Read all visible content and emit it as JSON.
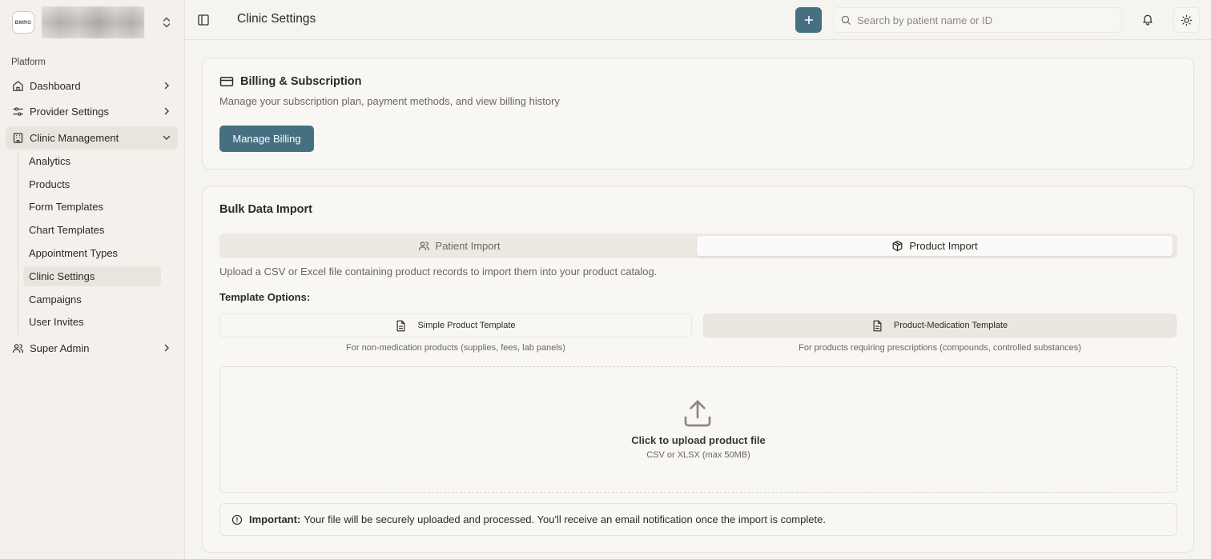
{
  "org": {
    "logo_text": "BMRG",
    "name": ""
  },
  "sidebar": {
    "group_label": "Platform",
    "items": [
      {
        "label": "Dashboard",
        "icon": "home-icon"
      },
      {
        "label": "Provider Settings",
        "icon": "sliders-icon"
      },
      {
        "label": "Clinic Management",
        "icon": "building-icon",
        "expanded": true
      },
      {
        "label": "Super Admin",
        "icon": "users-icon"
      }
    ],
    "sub_items": [
      "Analytics",
      "Products",
      "Form Templates",
      "Chart Templates",
      "Appointment Types",
      "Clinic Settings",
      "Campaigns",
      "User Invites"
    ],
    "active_sub_item": "Clinic Settings"
  },
  "header": {
    "title": "Clinic Settings",
    "search_placeholder": "Search by patient name or ID"
  },
  "billing": {
    "title": "Billing & Subscription",
    "description": "Manage your subscription plan, payment methods, and view billing history",
    "button_label": "Manage Billing"
  },
  "import": {
    "title": "Bulk Data Import",
    "tabs": [
      {
        "label": "Patient Import",
        "icon": "users-icon",
        "active": false
      },
      {
        "label": "Product Import",
        "icon": "package-icon",
        "active": true
      }
    ],
    "description": "Upload a CSV or Excel file containing product records to import them into your product catalog.",
    "template_options_label": "Template Options:",
    "templates": [
      {
        "label": "Simple Product Template",
        "hint": "For non-medication products (supplies, fees, lab panels)",
        "icon": "file-text-icon"
      },
      {
        "label": "Product-Medication Template",
        "hint": "For products requiring prescriptions (compounds, controlled substances)",
        "icon": "file-text-icon"
      }
    ],
    "dropzone": {
      "title": "Click to upload product file",
      "subtitle": "CSV or XLSX (max 50MB)"
    },
    "notice": {
      "label": "Important:",
      "text": "Your file will be securely uploaded and processed. You'll receive an email notification once the import is complete."
    }
  },
  "colors": {
    "accent": "#466f82",
    "background": "#f6f4f0",
    "sidebar_background": "#f4f1ec"
  }
}
